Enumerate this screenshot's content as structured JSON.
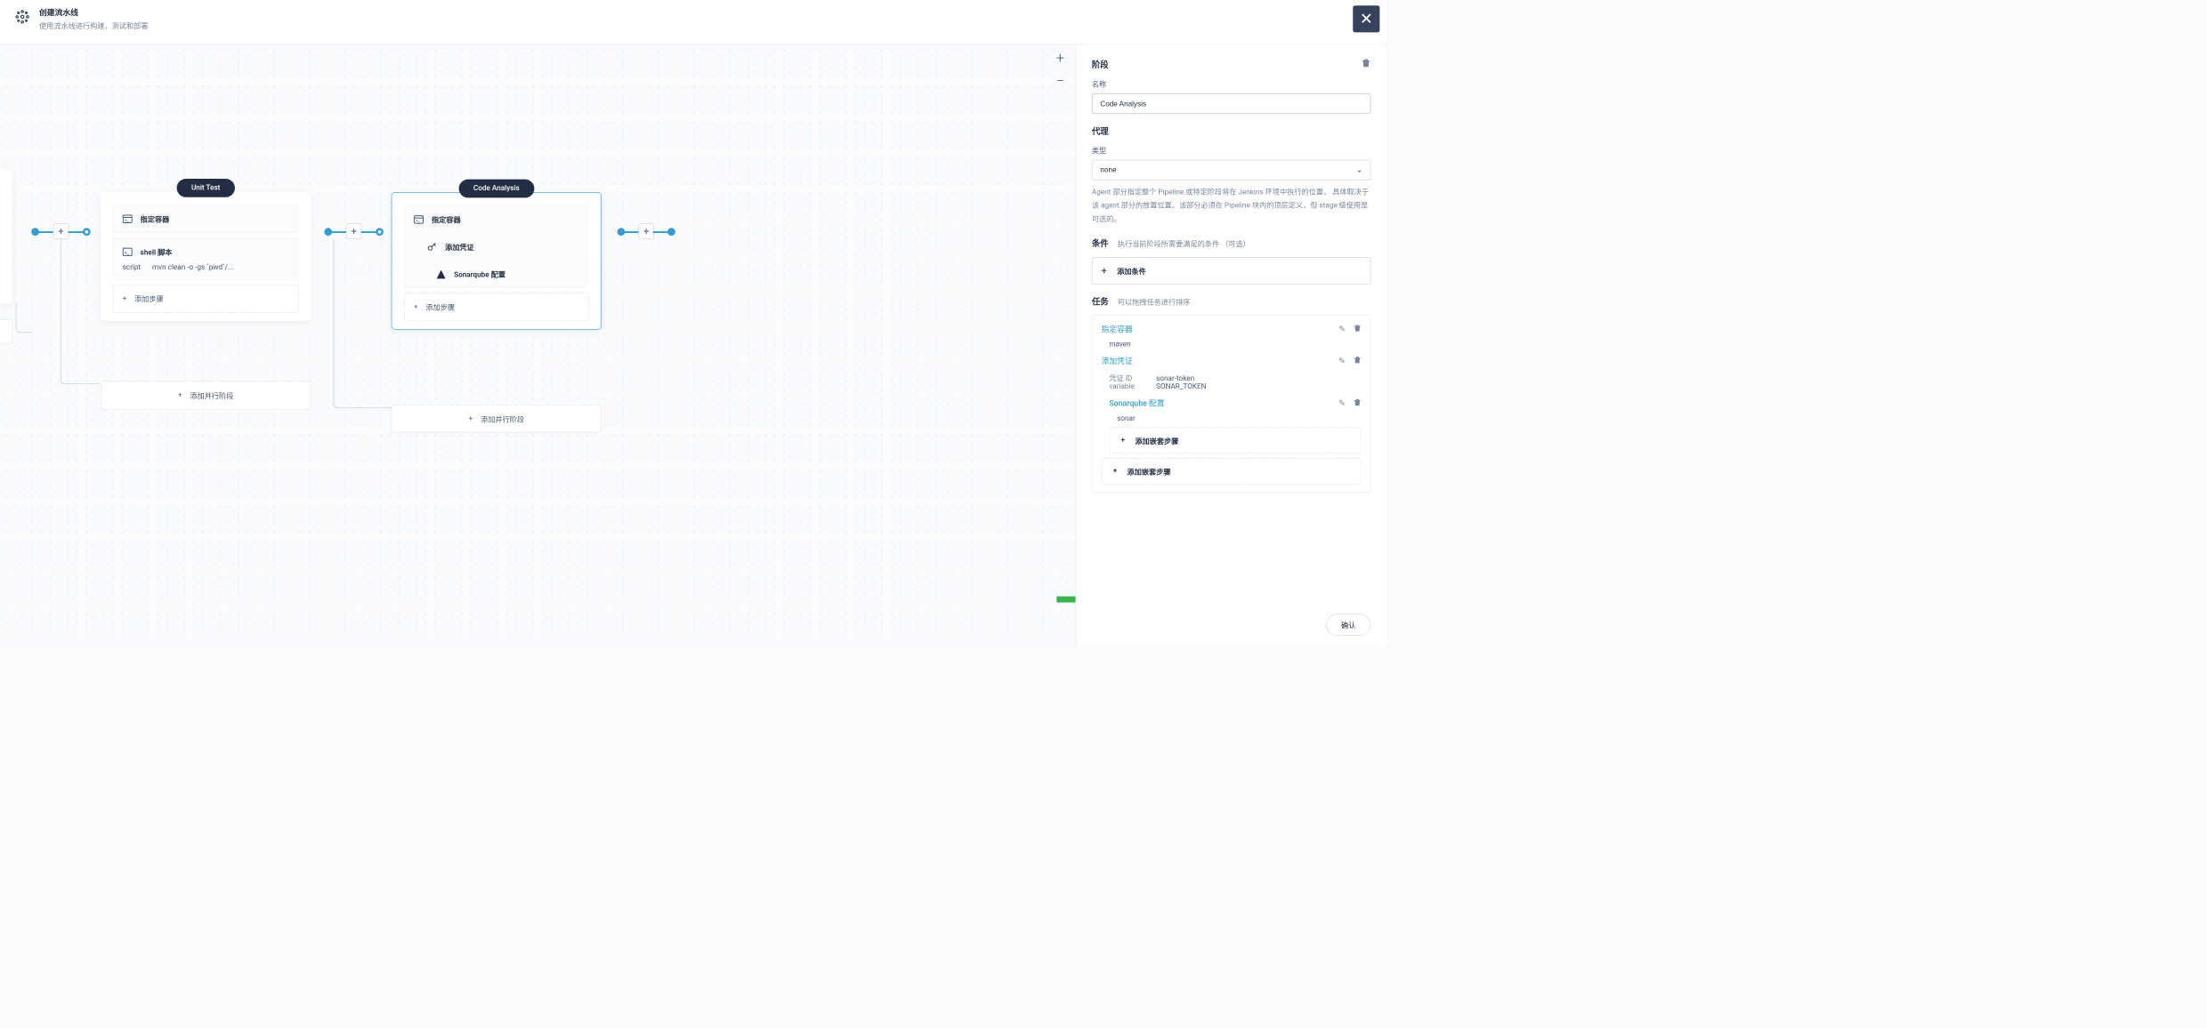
{
  "header": {
    "title": "创建流水线",
    "subtitle": "使用流水线进行构建，测试和部署"
  },
  "canvas": {
    "stages": [
      {
        "badge": "Unit Test",
        "steps": [
          {
            "icon": "container",
            "label": "指定容器"
          },
          {
            "icon": "shell",
            "label": "shell 脚本",
            "script_key": "script",
            "script_val": "mvn clean -o -gs `pwd`/..."
          }
        ],
        "add_step": "添加步骤",
        "add_parallel": "添加并行阶段"
      },
      {
        "badge": "Code Analysis",
        "steps": [
          {
            "icon": "container",
            "label": "指定容器"
          },
          {
            "icon": "key",
            "label": "添加凭证"
          },
          {
            "icon": "sonar",
            "label": "Sonarqube 配置"
          }
        ],
        "add_step": "添加步骤",
        "add_parallel": "添加并行阶段"
      }
    ]
  },
  "panel": {
    "stage_heading": "阶段",
    "name_label": "名称",
    "name_value": "Code Analysis",
    "agent_heading": "代理",
    "type_label": "类型",
    "type_value": "none",
    "agent_help": "Agent 部分指定整个 Pipeline 或特定阶段将在 Jenkins 环境中执行的位置， 具体取决于该 agent 部分的放置位置。该部分必须在 Pipeline 块内的顶层定义，但 stage 级使用是可选的。",
    "cond_heading": "条件",
    "cond_sub": "执行当前阶段所需要满足的条件 （可选）",
    "add_cond": "添加条件",
    "task_heading": "任务",
    "task_sub": "可以拖拽任务进行排序",
    "tasks": {
      "t0": {
        "title": "指定容器",
        "val": "maven"
      },
      "t1": {
        "title": "添加凭证",
        "kv": [
          {
            "k": "凭证 ID",
            "v": "sonar-token"
          },
          {
            "k": "variable",
            "v": "SONAR_TOKEN"
          }
        ]
      },
      "t2": {
        "title": "Sonarqube 配置",
        "val": "sonar"
      }
    },
    "add_nested": "添加嵌套步骤",
    "confirm": "确认"
  }
}
